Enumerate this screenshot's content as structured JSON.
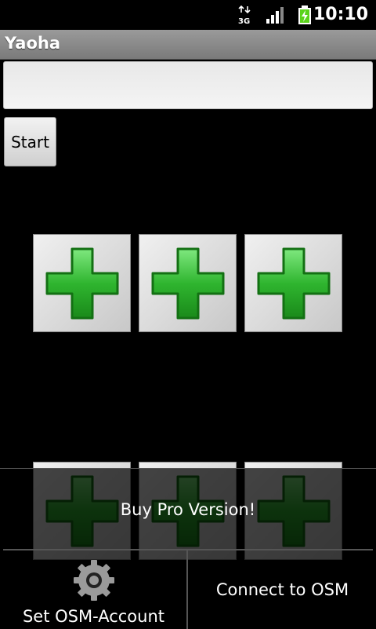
{
  "status_bar": {
    "network": "3G",
    "time": "10:10"
  },
  "app": {
    "title": "Yaoha"
  },
  "search": {
    "value": "",
    "placeholder": ""
  },
  "start_button": {
    "label": "Start"
  },
  "tiles": [
    {
      "icon": "green-plus-icon"
    },
    {
      "icon": "green-plus-icon"
    },
    {
      "icon": "green-plus-icon"
    },
    {
      "icon": "green-plus-icon"
    },
    {
      "icon": "green-plus-icon"
    },
    {
      "icon": "green-plus-icon"
    }
  ],
  "menu": {
    "promo": "Buy Pro Version!",
    "set_account": "Set OSM-Account",
    "connect": "Connect to OSM"
  },
  "colors": {
    "plus": "#2fb52f",
    "title_bar": "#8a8a8a"
  }
}
